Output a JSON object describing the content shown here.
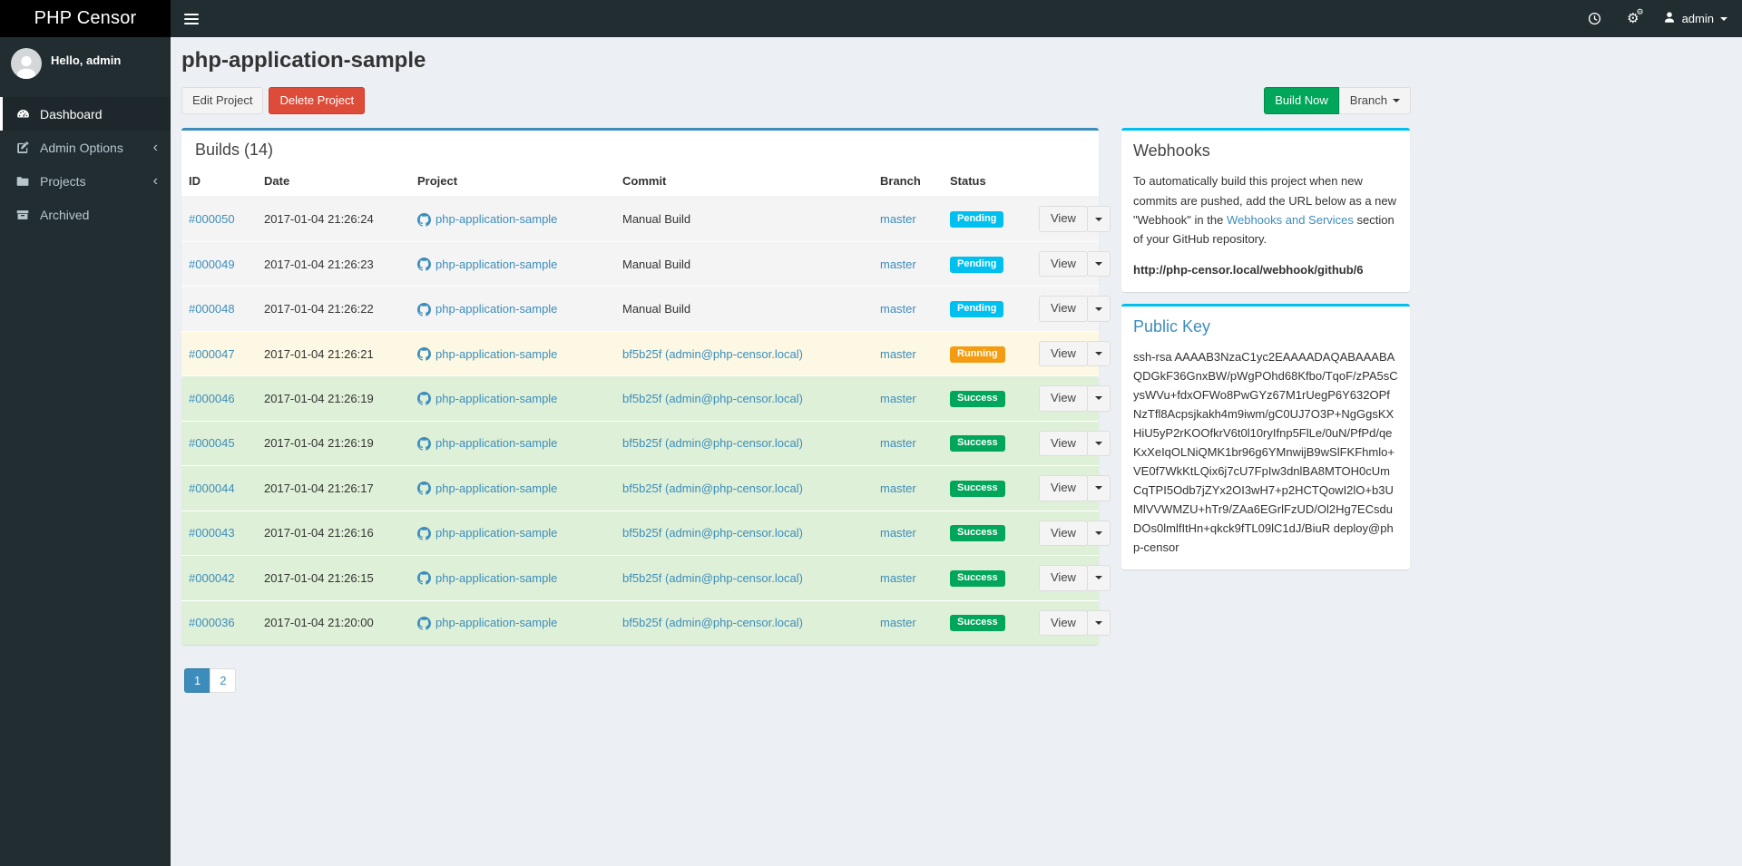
{
  "colors": {
    "accent-primary": "#3c8dbc",
    "accent-info": "#00c0ef",
    "status-pending": "#00c0ef",
    "status-running": "#f39c12",
    "status-success": "#00a65a",
    "btn-danger": "#dd4b39",
    "btn-success": "#00a65a",
    "row-pending-bg": "#f4f4f4",
    "row-running-bg": "#fcf8e3",
    "row-success-bg": "#dff0d8"
  },
  "navbar": {
    "brand": "PHP Censor",
    "user": "admin"
  },
  "sidebar": {
    "greeting": "Hello, admin",
    "items": [
      {
        "label": "Dashboard",
        "icon": "dashboard-icon",
        "active": true,
        "has_submenu": false
      },
      {
        "label": "Admin Options",
        "icon": "edit-icon",
        "active": false,
        "has_submenu": true
      },
      {
        "label": "Projects",
        "icon": "folder-icon",
        "active": false,
        "has_submenu": true
      },
      {
        "label": "Archived",
        "icon": "archive-icon",
        "active": false,
        "has_submenu": false
      }
    ]
  },
  "page": {
    "title": "php-application-sample"
  },
  "toolbar": {
    "edit_label": "Edit Project",
    "delete_label": "Delete Project",
    "build_now_label": "Build Now",
    "branch_label": "Branch"
  },
  "builds": {
    "title": "Builds (14)",
    "columns": [
      "ID",
      "Date",
      "Project",
      "Commit",
      "Branch",
      "Status"
    ],
    "view_label": "View",
    "rows": [
      {
        "id": "#000050",
        "date": "2017-01-04 21:26:24",
        "project": "php-application-sample",
        "commit": "Manual Build",
        "commit_is_link": false,
        "branch": "master",
        "status": "Pending"
      },
      {
        "id": "#000049",
        "date": "2017-01-04 21:26:23",
        "project": "php-application-sample",
        "commit": "Manual Build",
        "commit_is_link": false,
        "branch": "master",
        "status": "Pending"
      },
      {
        "id": "#000048",
        "date": "2017-01-04 21:26:22",
        "project": "php-application-sample",
        "commit": "Manual Build",
        "commit_is_link": false,
        "branch": "master",
        "status": "Pending"
      },
      {
        "id": "#000047",
        "date": "2017-01-04 21:26:21",
        "project": "php-application-sample",
        "commit": "bf5b25f (admin@php-censor.local)",
        "commit_is_link": true,
        "branch": "master",
        "status": "Running"
      },
      {
        "id": "#000046",
        "date": "2017-01-04 21:26:19",
        "project": "php-application-sample",
        "commit": "bf5b25f (admin@php-censor.local)",
        "commit_is_link": true,
        "branch": "master",
        "status": "Success"
      },
      {
        "id": "#000045",
        "date": "2017-01-04 21:26:19",
        "project": "php-application-sample",
        "commit": "bf5b25f (admin@php-censor.local)",
        "commit_is_link": true,
        "branch": "master",
        "status": "Success"
      },
      {
        "id": "#000044",
        "date": "2017-01-04 21:26:17",
        "project": "php-application-sample",
        "commit": "bf5b25f (admin@php-censor.local)",
        "commit_is_link": true,
        "branch": "master",
        "status": "Success"
      },
      {
        "id": "#000043",
        "date": "2017-01-04 21:26:16",
        "project": "php-application-sample",
        "commit": "bf5b25f (admin@php-censor.local)",
        "commit_is_link": true,
        "branch": "master",
        "status": "Success"
      },
      {
        "id": "#000042",
        "date": "2017-01-04 21:26:15",
        "project": "php-application-sample",
        "commit": "bf5b25f (admin@php-censor.local)",
        "commit_is_link": true,
        "branch": "master",
        "status": "Success"
      },
      {
        "id": "#000036",
        "date": "2017-01-04 21:20:00",
        "project": "php-application-sample",
        "commit": "bf5b25f (admin@php-censor.local)",
        "commit_is_link": true,
        "branch": "master",
        "status": "Success"
      }
    ]
  },
  "pagination": {
    "pages": [
      "1",
      "2"
    ],
    "active": "1"
  },
  "webhooks": {
    "title": "Webhooks",
    "text_before": "To automatically build this project when new commits are pushed, add the URL below as a new \"Webhook\" in the",
    "link_text": "Webhooks and Services",
    "text_after": "section of your GitHub repository.",
    "url": "http://php-censor.local/webhook/github/6"
  },
  "public_key": {
    "title": "Public Key",
    "key": "ssh-rsa AAAAB3NzaC1yc2EAAAADAQABAAABAQDGkF36GnxBW/pWgPOhd68Kfbo/TqoF/zPA5sCysWVu+fdxOFWo8PwGYz67M1rUegP6Y632OPfNzTfl8Acpsjkakh4m9iwm/gC0UJ7O3P+NgGgsKXHiU5yP2rKOOfkrV6t0l10ryIfnp5FlLe/0uN/PfPd/qeKxXeIqOLNiQMK1br96g6YMnwijB9wSlFKFhmlo+VE0f7WkKtLQix6j7cU7FpIw3dnlBA8MTOH0cUmCqTPI5Odb7jZYx2OI3wH7+p2HCTQowI2lO+b3UMlVVWMZU+hTr9/ZAa6EGrlFzUD/Ol2Hg7ECsduDOs0lmlfItHn+qkck9fTL09lC1dJ/BiuR deploy@php-censor"
  }
}
